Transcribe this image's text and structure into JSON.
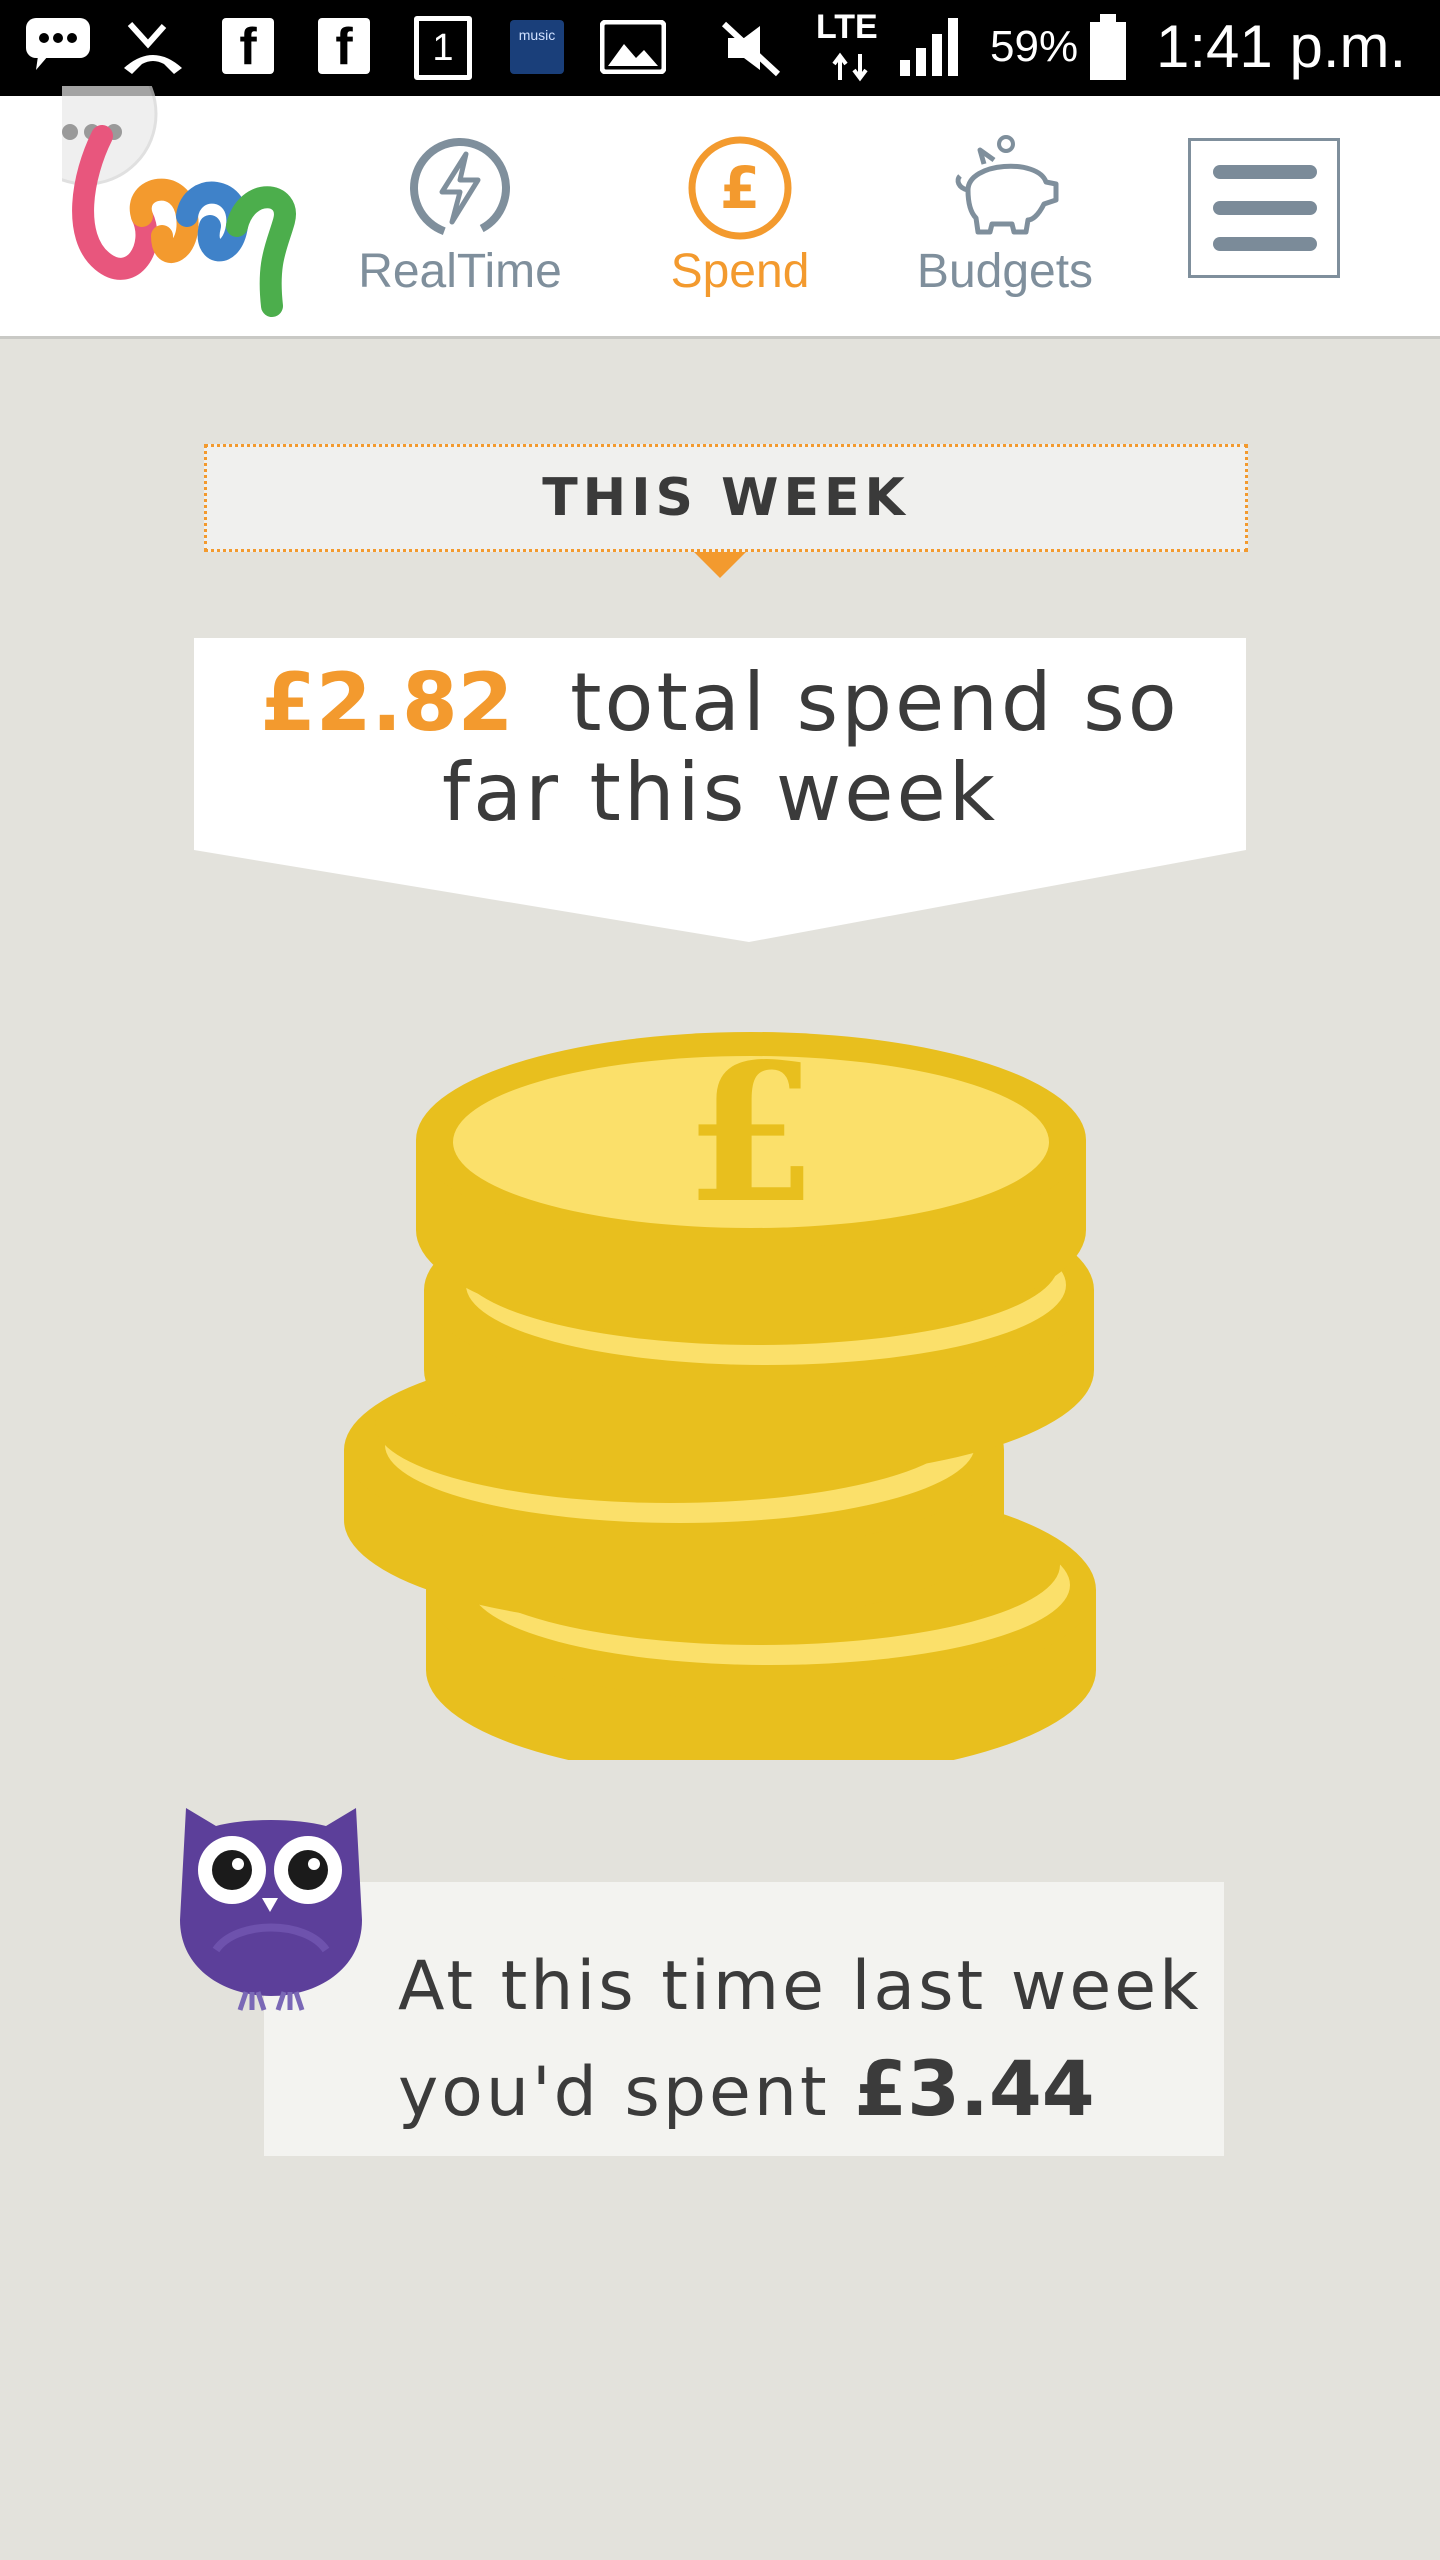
{
  "status_bar": {
    "icons": [
      "chat-bubble-icon",
      "missed-call-icon",
      "facebook-icon",
      "facebook-icon",
      "calendar-icon",
      "amazon-music-icon",
      "gallery-icon",
      "mute-icon",
      "lte-icon",
      "signal-icon",
      "battery-icon"
    ],
    "one_badge": "1",
    "music_badge": "music",
    "network": "LTE",
    "battery": "59%",
    "time": "1:41 p.m."
  },
  "nav": {
    "tabs": [
      {
        "label": "RealTime",
        "icon": "lightning-icon",
        "active": false,
        "color": "#7f8f9c"
      },
      {
        "label": "Spend",
        "icon": "pound-icon",
        "active": true,
        "color": "#f39a2e"
      },
      {
        "label": "Budgets",
        "icon": "piggy-bank-icon",
        "active": false,
        "color": "#7f8f9c"
      }
    ],
    "menu_icon": "hamburger-menu-icon"
  },
  "period": {
    "label": "THIS WEEK"
  },
  "total": {
    "amount": "£2.82",
    "text": "total spend so far this week"
  },
  "comparison": {
    "text": "At this time last week you'd spent",
    "amount": "£3.44",
    "mascot": "owl-icon"
  },
  "colors": {
    "accent": "#f39a2e",
    "background": "#e3e2dc",
    "coin": "#e8bf1e",
    "coin_highlight": "#fbe06a",
    "owl": "#5c3f9a"
  }
}
